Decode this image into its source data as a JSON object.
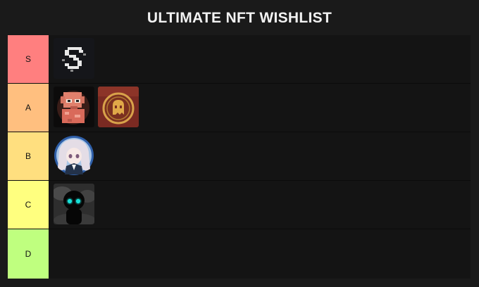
{
  "title": "ULTIMATE NFT WISHLIST",
  "tiers": [
    {
      "label": "S",
      "color": "#ff7f7f",
      "items": [
        "s-logo-nft"
      ]
    },
    {
      "label": "A",
      "color": "#ffbf7f",
      "items": [
        "pixel-skull-nft",
        "ghost-coin-nft"
      ]
    },
    {
      "label": "B",
      "color": "#ffdf7f",
      "items": [
        "anime-girl-nft"
      ]
    },
    {
      "label": "C",
      "color": "#ffff7f",
      "items": [
        "shadow-figure-nft"
      ]
    },
    {
      "label": "D",
      "color": "#bfff7f",
      "items": []
    }
  ]
}
